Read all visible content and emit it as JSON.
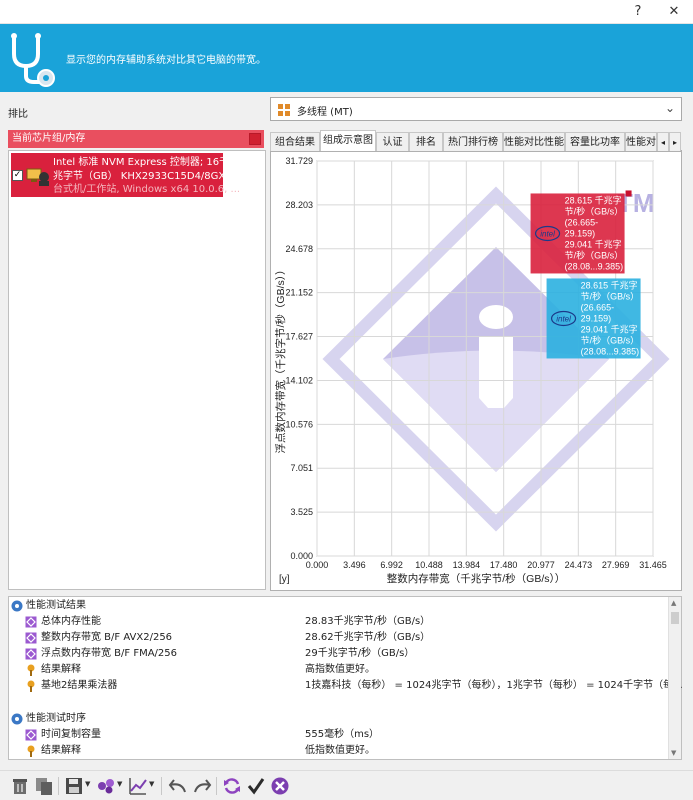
{
  "window": {
    "help_label": "?",
    "close_label": "✕"
  },
  "banner": {
    "text": "显示您的内存辅助系统对比其它电脑的带宽。",
    "icon": "stethoscope-icon"
  },
  "left": {
    "rank_label": "排比",
    "category_label": "当前芯片组/内存",
    "category_color": "#e94f5f",
    "item": {
      "line1": "Intel 标准 NVM Express 控制器; 16千",
      "line2": "兆字节（GB） KHX2933C15D4/8GX ...",
      "line3": "台式机/工作站, Windows x64 10.0.6, ...",
      "checked": true
    }
  },
  "mode_select": {
    "value": "多线程 (MT)"
  },
  "tabs": [
    "组合结果",
    "组成示意图",
    "认证",
    "排名",
    "热门排行榜",
    "性能对比性能",
    "容量比功率",
    "性能对比"
  ],
  "active_tab": 1,
  "chart_data": {
    "type": "scatter",
    "xlabel": "整数内存带宽（千兆字节/秒（GB/s））",
    "ylabel": "浮点数内存带宽（千兆字节/秒（GB/s））",
    "corner_label": "[y]",
    "xticks": [
      "0.000",
      "3.496",
      "6.992",
      "10.488",
      "13.984",
      "17.480",
      "20.977",
      "24.473",
      "27.969",
      "31.465"
    ],
    "yticks": [
      "0.000",
      "3.525",
      "7.051",
      "10.576",
      "14.102",
      "17.627",
      "21.152",
      "24.678",
      "28.203",
      "31.729"
    ],
    "xlim": [
      0,
      31.465
    ],
    "ylim": [
      0,
      31.729
    ],
    "grid": true,
    "series": [
      {
        "color": "#d9213d",
        "x": 28.615,
        "y": 29.041,
        "label": [
          "28.615 千兆字",
          "节/秒（GB/s）",
          "(26.665-",
          "29.159)",
          "29.041 千兆字",
          "节/秒（GB/s）",
          "(28.08...9.385)"
        ]
      },
      {
        "color": "#2bb0e0",
        "x": 28.615,
        "y": 29.041,
        "label": [
          "28.615 千兆字",
          "节/秒（GB/s）",
          "(26.665-",
          "29.159)",
          "29.041 千兆字",
          "节/秒（GB/s）",
          "(28.08...9.385)"
        ]
      }
    ],
    "watermark_text": "TM"
  },
  "results": {
    "section1_title": "性能测试结果",
    "rows1": [
      {
        "label": "总体内存性能",
        "value": "28.83千兆字节/秒（GB/s）",
        "icon": "purple-diamond-icon"
      },
      {
        "label": "整数内存带宽 B/F AVX2/256",
        "value": "28.62千兆字节/秒（GB/s）",
        "icon": "purple-diamond-icon"
      },
      {
        "label": "浮点数内存带宽 B/F FMA/256",
        "value": "29千兆字节/秒（GB/s）",
        "icon": "purple-diamond-icon"
      },
      {
        "label": "结果解释",
        "value": "高指数值更好。",
        "icon": "pin-icon"
      },
      {
        "label": "基地2结果乘法器",
        "value": "1技嘉科技（每秒） = 1024兆字节（每秒），1兆字节（每秒） = 1024千字节（每...",
        "icon": "pin-icon"
      }
    ],
    "section2_title": "性能测试时序",
    "rows2": [
      {
        "label": "时间复制容量",
        "value": "555毫秒（ms）",
        "icon": "purple-diamond-icon"
      },
      {
        "label": "结果解释",
        "value": "低指数值更好。",
        "icon": "pin-icon"
      }
    ]
  },
  "toolbar": {
    "icons": [
      "delete-icon",
      "copy-icon",
      "save-icon",
      "options-icon",
      "chart-icon",
      "undo-icon",
      "redo-icon",
      "refresh-icon",
      "ok-icon",
      "cancel-icon"
    ]
  }
}
